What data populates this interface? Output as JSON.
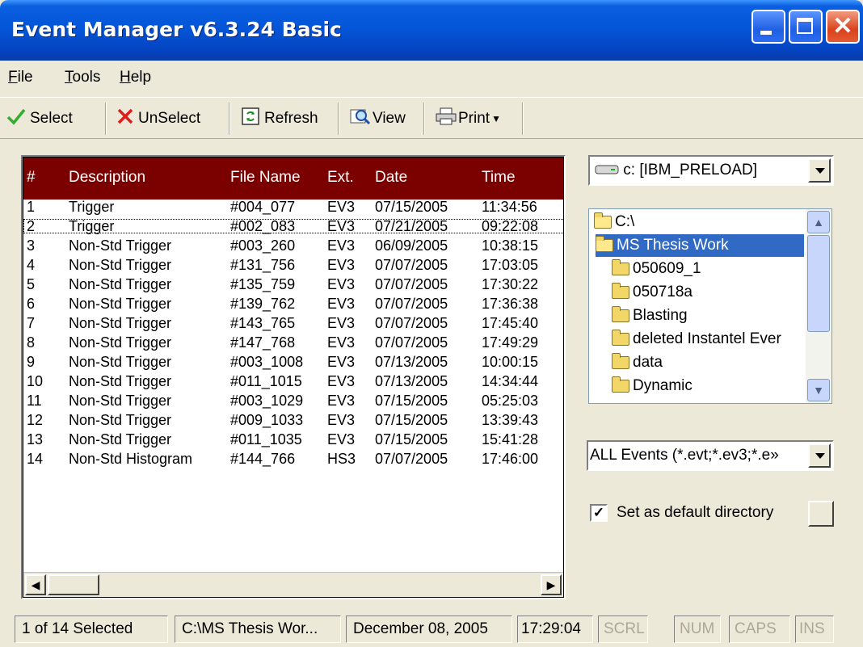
{
  "window": {
    "title": "Event Manager v6.3.24 Basic"
  },
  "menu": [
    {
      "label": "File",
      "key": "F",
      "rest": "ile"
    },
    {
      "label": "Tools",
      "key": "T",
      "rest": "ools"
    },
    {
      "label": "Help",
      "key": "H",
      "rest": "elp"
    }
  ],
  "toolbar": {
    "select": "Select",
    "unselect": "UnSelect",
    "refresh": "Refresh",
    "view": "View",
    "print": "Print"
  },
  "list": {
    "columns": [
      "#",
      "Description",
      "File Name",
      "Ext.",
      "Date",
      "Time"
    ],
    "rows": [
      [
        "1",
        "Trigger",
        "#004_077",
        "EV3",
        "07/15/2005",
        "11:34:56"
      ],
      [
        "2",
        "Trigger",
        "#002_083",
        "EV3",
        "07/21/2005",
        "09:22:08"
      ],
      [
        "3",
        "Non-Std Trigger",
        "#003_260",
        "EV3",
        "06/09/2005",
        "10:38:15"
      ],
      [
        "4",
        "Non-Std Trigger",
        "#131_756",
        "EV3",
        "07/07/2005",
        "17:03:05"
      ],
      [
        "5",
        "Non-Std Trigger",
        "#135_759",
        "EV3",
        "07/07/2005",
        "17:30:22"
      ],
      [
        "6",
        "Non-Std Trigger",
        "#139_762",
        "EV3",
        "07/07/2005",
        "17:36:38"
      ],
      [
        "7",
        "Non-Std Trigger",
        "#143_765",
        "EV3",
        "07/07/2005",
        "17:45:40"
      ],
      [
        "8",
        "Non-Std Trigger",
        "#147_768",
        "EV3",
        "07/07/2005",
        "17:49:29"
      ],
      [
        "9",
        "Non-Std Trigger",
        "#003_1008",
        "EV3",
        "07/13/2005",
        "10:00:15"
      ],
      [
        "10",
        "Non-Std Trigger",
        "#011_1015",
        "EV3",
        "07/13/2005",
        "14:34:44"
      ],
      [
        "11",
        "Non-Std Trigger",
        "#003_1029",
        "EV3",
        "07/15/2005",
        "05:25:03"
      ],
      [
        "12",
        "Non-Std Trigger",
        "#009_1033",
        "EV3",
        "07/15/2005",
        "13:39:43"
      ],
      [
        "13",
        "Non-Std Trigger",
        "#011_1035",
        "EV3",
        "07/15/2005",
        "15:41:28"
      ],
      [
        "14",
        "Non-Std Histogram",
        "#144_766",
        "HS3",
        "07/07/2005",
        "17:46:00"
      ]
    ]
  },
  "drive": {
    "value": "c: [IBM_PRELOAD]"
  },
  "directories": [
    {
      "label": "C:\\",
      "open": true,
      "selected": false
    },
    {
      "label": "MS Thesis Work",
      "open": true,
      "selected": true
    },
    {
      "label": "050609_1",
      "open": false,
      "selected": false
    },
    {
      "label": "050718a",
      "open": false,
      "selected": false
    },
    {
      "label": "Blasting",
      "open": false,
      "selected": false
    },
    {
      "label": "deleted Instantel Ever",
      "open": false,
      "selected": false
    },
    {
      "label": "data",
      "open": false,
      "selected": false
    },
    {
      "label": "Dynamic",
      "open": false,
      "selected": false
    }
  ],
  "filter": {
    "value": "ALL Events (*.evt;*.ev3;*.e»"
  },
  "default_dir": {
    "label": "Set as default directory",
    "checked": true
  },
  "status": {
    "selection": "1 of 14 Selected",
    "path": "C:\\MS Thesis Wor...",
    "date": "December 08, 2005",
    "time": "17:29:04",
    "scrl": "SCRL",
    "num": "NUM",
    "caps": "CAPS",
    "ins": "INS"
  }
}
